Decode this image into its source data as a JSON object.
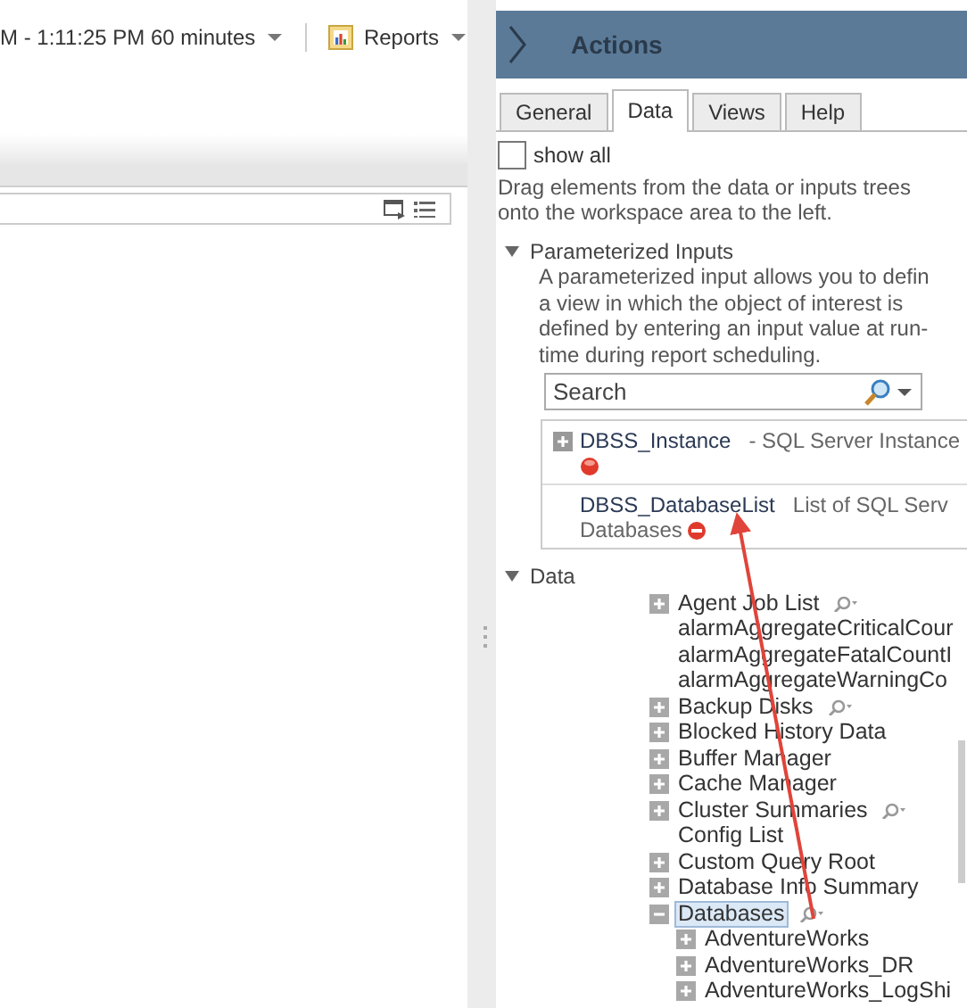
{
  "toolbar": {
    "time_range": "M - 1:11:25 PM 60 minutes",
    "reports_label": "Reports"
  },
  "actions_panel": {
    "title": "Actions",
    "tabs": [
      {
        "label": "General",
        "selected": false
      },
      {
        "label": "Data",
        "selected": true
      },
      {
        "label": "Views",
        "selected": false
      },
      {
        "label": "Help",
        "selected": false
      }
    ],
    "show_all": {
      "label": "show all",
      "checked": false
    },
    "hint": "Drag elements from the data or inputs trees onto the workspace area to the left.",
    "parameterized_inputs": {
      "title": "Parameterized Inputs",
      "expanded": true,
      "description_lines": [
        "A parameterized input allows you to defin",
        "a view in which the object of interest is",
        "defined by entering an input value at run-",
        "time during report scheduling."
      ],
      "search": {
        "placeholder": "Search"
      },
      "inputs": [
        {
          "name": "DBSS_Instance",
          "description": "- SQL Server Instance",
          "kind": "error",
          "expandable": true
        },
        {
          "name": "DBSS_DatabaseList",
          "description": "List of SQL Serv",
          "description_2": "Databases",
          "kind": "remove",
          "expandable": false
        }
      ]
    },
    "data": {
      "title": "Data",
      "expanded": true,
      "tree": [
        {
          "label": "Agent Job List",
          "kind": "expandable",
          "expanded": false,
          "selected": false,
          "filter": true
        },
        {
          "label": "alarmAggregateCriticalCour",
          "kind": "leaf",
          "selected": false,
          "filter": false
        },
        {
          "label": "alarmAggregateFatalCountI",
          "kind": "leaf",
          "selected": false,
          "filter": false
        },
        {
          "label": "alarmAggregateWarningCo",
          "kind": "leaf",
          "selected": false,
          "filter": false
        },
        {
          "label": "Backup Disks",
          "kind": "expandable",
          "expanded": false,
          "selected": false,
          "filter": true
        },
        {
          "label": "Blocked History Data",
          "kind": "expandable",
          "expanded": false,
          "selected": false,
          "filter": false
        },
        {
          "label": "Buffer Manager",
          "kind": "expandable",
          "expanded": false,
          "selected": false,
          "filter": false
        },
        {
          "label": "Cache Manager",
          "kind": "expandable",
          "expanded": false,
          "selected": false,
          "filter": false
        },
        {
          "label": "Cluster Summaries",
          "kind": "expandable",
          "expanded": false,
          "selected": false,
          "filter": true
        },
        {
          "label": "Config List",
          "kind": "leaf",
          "selected": false,
          "filter": false
        },
        {
          "label": "Custom Query Root",
          "kind": "expandable",
          "expanded": false,
          "selected": false,
          "filter": false
        },
        {
          "label": "Database Info Summary",
          "kind": "expandable",
          "expanded": false,
          "selected": false,
          "filter": false
        },
        {
          "label": "Databases",
          "kind": "expandable",
          "expanded": true,
          "selected": true,
          "filter": true,
          "children": [
            {
              "label": "AdventureWorks",
              "kind": "expandable",
              "expanded": false,
              "selected": false,
              "filter": false
            },
            {
              "label": "AdventureWorks_DR",
              "kind": "expandable",
              "expanded": false,
              "selected": false,
              "filter": false
            },
            {
              "label": "AdventureWorks_LogShi",
              "kind": "expandable",
              "expanded": false,
              "selected": false,
              "filter": false
            }
          ]
        }
      ]
    }
  }
}
